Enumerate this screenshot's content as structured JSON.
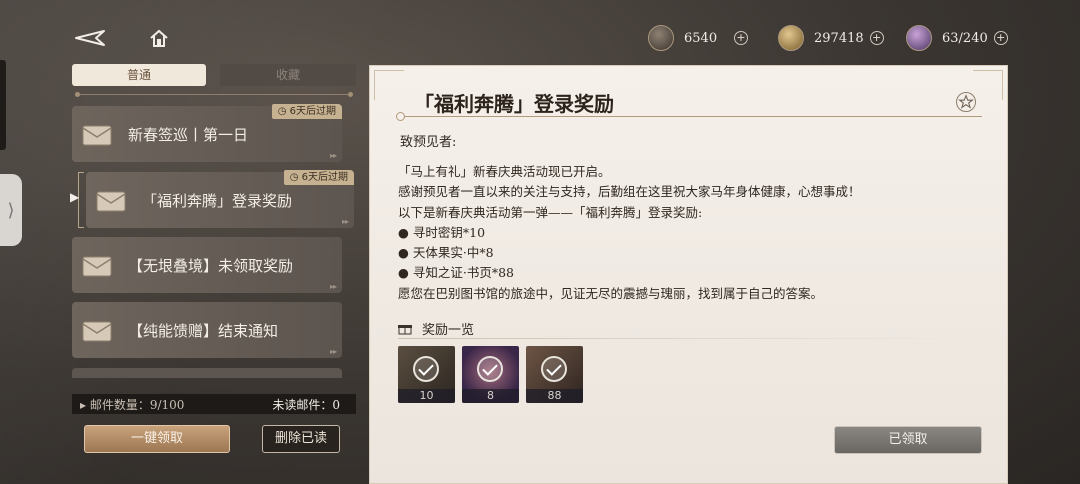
{
  "header": {
    "currencies": [
      {
        "icon": "quill-currency-icon",
        "value": "6540"
      },
      {
        "icon": "gold-coin-icon",
        "value": "297418"
      },
      {
        "icon": "stamina-orb-icon",
        "value": "63/240"
      }
    ]
  },
  "tabs": [
    {
      "label": "普通",
      "active": true
    },
    {
      "label": "收藏",
      "active": false
    }
  ],
  "mail_list": {
    "items": [
      {
        "title": "新春签巡丨第一日",
        "expiry": "6天后过期",
        "selected": false
      },
      {
        "title": "「福利奔腾」登录奖励",
        "expiry": "6天后过期",
        "selected": true
      },
      {
        "title": "【无垠叠境】未领取奖励",
        "expiry": "",
        "selected": false
      },
      {
        "title": "【纯能馈赠】结束通知",
        "expiry": "",
        "selected": false
      }
    ],
    "count_label": "邮件数量：9/100",
    "unread_label": "未读邮件：0"
  },
  "actions": {
    "claim_all": "一键领取",
    "delete_read": "删除已读"
  },
  "mail_detail": {
    "title": "「福利奔腾」登录奖励",
    "greeting": "致预见者:",
    "body": [
      "「马上有礼」新春庆典活动现已开启。",
      " 感谢预见者一直以来的关注与支持，后勤组在这里祝大家马年身体健康，心想事成！",
      "以下是新春庆典活动第一弹——「福利奔腾」登录奖励:",
      "● 寻时密钥*10",
      "● 天体果实·中*8",
      "● 寻知之证·书页*88",
      "愿您在巴别图书馆的旅途中，见证无尽的震撼与瑰丽，找到属于自己的答案。"
    ],
    "rewards_heading": "奖励一览",
    "rewards": [
      {
        "qty": "10",
        "color": "#3a332c"
      },
      {
        "qty": "8",
        "color": "#4a3550"
      },
      {
        "qty": "88",
        "color": "#4a3a30"
      }
    ],
    "claimed_button": "已领取"
  }
}
